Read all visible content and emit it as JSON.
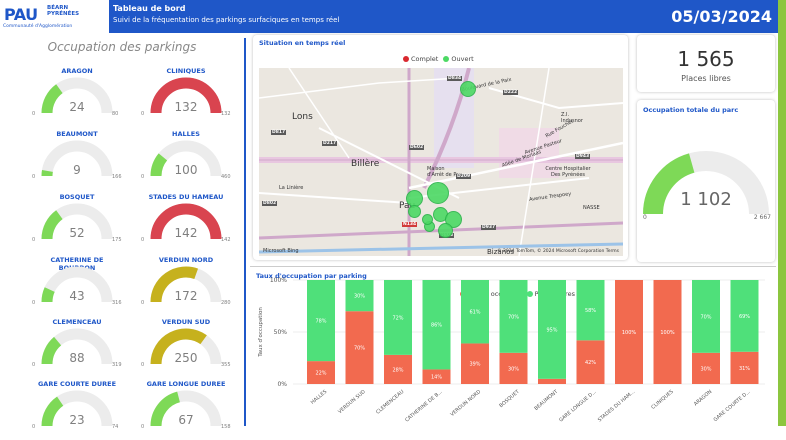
{
  "header": {
    "logo_text": "PAU",
    "logo_region_1": "BÉARN",
    "logo_region_2": "PYRÉNÉES",
    "logo_sub": "Communauté d'Agglomération",
    "title": "Tableau de bord",
    "subtitle": "Suivi de la fréquentation des parkings surfaciques en temps réel",
    "date": "05/03/2024"
  },
  "colors": {
    "brand": "#1f57c8",
    "green": "#7ed957",
    "red": "#d9444f",
    "gold": "#c6b11d",
    "accent_green": "#8cc63f",
    "bar_red": "#f26a4f",
    "bar_green": "#4fe07a"
  },
  "left_panel": {
    "title": "Occupation des parkings",
    "gauges": [
      {
        "name": "ARAGON",
        "value": "24",
        "min": "0",
        "max": "80",
        "fraction": 0.3,
        "color": "green"
      },
      {
        "name": "CLINIQUES",
        "value": "132",
        "min": "0",
        "max": "132",
        "fraction": 1.0,
        "color": "red"
      },
      {
        "name": "BEAUMONT",
        "value": "9",
        "min": "0",
        "max": "166",
        "fraction": 0.054,
        "color": "green"
      },
      {
        "name": "HALLES",
        "value": "100",
        "min": "0",
        "max": "460",
        "fraction": 0.22,
        "color": "green"
      },
      {
        "name": "BOSQUET",
        "value": "52",
        "min": "0",
        "max": "175",
        "fraction": 0.3,
        "color": "green"
      },
      {
        "name": "STADES DU HAMEAU",
        "value": "142",
        "min": "0",
        "max": "142",
        "fraction": 1.0,
        "color": "red"
      },
      {
        "name": "CATHERINE DE BOURBON",
        "value": "43",
        "min": "0",
        "max": "316",
        "fraction": 0.136,
        "color": "green"
      },
      {
        "name": "VERDUN NORD",
        "value": "172",
        "min": "0",
        "max": "280",
        "fraction": 0.61,
        "color": "gold"
      },
      {
        "name": "CLEMENCEAU",
        "value": "88",
        "min": "0",
        "max": "319",
        "fraction": 0.276,
        "color": "green"
      },
      {
        "name": "VERDUN SUD",
        "value": "250",
        "min": "0",
        "max": "355",
        "fraction": 0.7,
        "color": "gold"
      },
      {
        "name": "GARE COURTE DUREE",
        "value": "23",
        "min": "0",
        "max": "74",
        "fraction": 0.31,
        "color": "green"
      },
      {
        "name": "GARE LONGUE DUREE",
        "value": "67",
        "min": "0",
        "max": "158",
        "fraction": 0.42,
        "color": "green"
      }
    ]
  },
  "map_card": {
    "title": "Situation en temps réel",
    "legend_full": "Complet",
    "legend_open": "Ouvert",
    "labels": [
      "Lons",
      "Billère",
      "Pau",
      "Maison d'Arrêt de Pau",
      "Centre Hospitalier Des Pyrénées",
      "Boulevard de la Paix",
      "Avenue Pasteur",
      "Allée de Morlaàs",
      "Z.I. Indusnor",
      "La Linière",
      "NASSE",
      "Bizanos",
      "Avenue Trespoey",
      "Rue Fouchet"
    ],
    "roads": [
      "D834",
      "D222",
      "D817",
      "D802",
      "D943",
      "D937",
      "D217",
      "D209",
      "N134",
      "D602",
      "D803"
    ],
    "bing": "Microsoft Bing",
    "attribution": "© 2024 TomTom, © 2024 Microsoft Corporation  Terms"
  },
  "places_card": {
    "value": "1 565",
    "label": "Places libres"
  },
  "occupancy_card": {
    "title": "Occupation totale du parc",
    "value": "1 102",
    "min": "0",
    "max": "2 667",
    "fraction": 0.413
  },
  "chart_data": {
    "type": "bar",
    "title": "Taux d'occupation par parking",
    "ylabel": "Taux d'occupation",
    "ylim": [
      0,
      100
    ],
    "yticks": [
      "0%",
      "50%",
      "100%"
    ],
    "categories": [
      "HALLES",
      "VERDUN SUD",
      "CLEMENCEAU",
      "CATHERINE DE B...",
      "VERDUN NORD",
      "BOSQUET",
      "BEAUMONT",
      "GARE LONGUE D...",
      "STADES DU HAM...",
      "CLINIQUES",
      "ARAGON",
      "GARE COURTE D..."
    ],
    "series": [
      {
        "name": "Places occupées",
        "color": "#f26a4f",
        "values": [
          22,
          70,
          28,
          14,
          39,
          30,
          5,
          42,
          100,
          100,
          30,
          31
        ],
        "labels": [
          "22%",
          "70%",
          "28%",
          "14%",
          "39%",
          "30%",
          "",
          "42%",
          "100%",
          "100%",
          "30%",
          "31%"
        ]
      },
      {
        "name": "Places libres",
        "color": "#4fe07a",
        "values": [
          78,
          30,
          72,
          86,
          61,
          70,
          95,
          58,
          0,
          0,
          70,
          69
        ],
        "labels": [
          "78%",
          "30%",
          "72%",
          "86%",
          "61%",
          "70%",
          "95%",
          "58%",
          "",
          "",
          "70%",
          "69%"
        ]
      }
    ],
    "legend": "top-center"
  }
}
